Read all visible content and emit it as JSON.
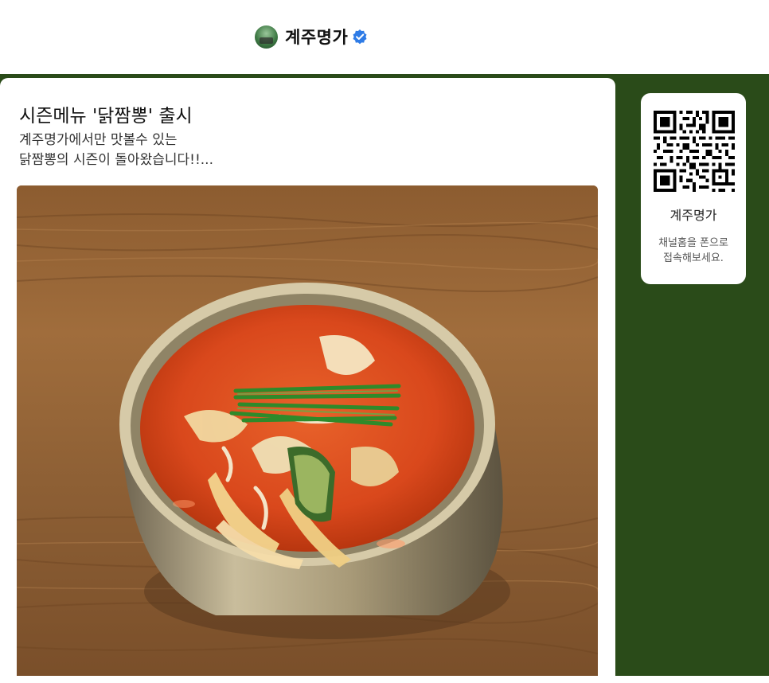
{
  "header": {
    "channel_name": "계주명가",
    "verified": true,
    "avatar_icon": "channel-avatar",
    "verified_icon": "verified-badge-icon",
    "verified_color": "#2e7be6"
  },
  "post": {
    "title": "시즌메뉴 '닭짬뽕' 출시",
    "description_line1": "계주명가에서만 맛볼수 있는",
    "description_line2": "닭짬뽕의 시즌이 돌아왔습니다!!...",
    "image_subject": "spicy chicken jjamppong soup in a metal bowl on a wooden table"
  },
  "sidebar": {
    "qr_icon": "qr-code-icon",
    "qr_channel_name": "계주명가",
    "qr_help_line1": "채널홈을 폰으로",
    "qr_help_line2": "접속해보세요."
  },
  "colors": {
    "background_green": "#2a4b19",
    "card_white": "#ffffff"
  }
}
